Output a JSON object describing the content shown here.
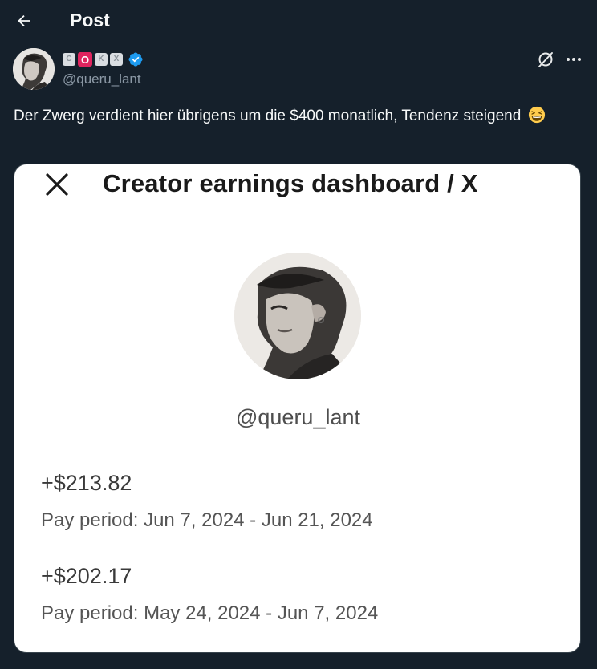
{
  "header": {
    "title": "Post"
  },
  "author": {
    "name_tiles": [
      "C",
      "O",
      "K",
      "X"
    ],
    "handle": "@queru_lant"
  },
  "tweet": {
    "text": "Der Zwerg verdient hier übrigens um die $400 monatlich, Tendenz steigend"
  },
  "dashboard": {
    "title": "Creator earnings dashboard / X",
    "handle": "@queru_lant",
    "payouts": [
      {
        "amount": "+$213.82",
        "period": "Pay period: Jun 7, 2024 - Jun 21, 2024"
      },
      {
        "amount": "+$202.17",
        "period": "Pay period: May 24, 2024 - Jun 7, 2024"
      }
    ]
  },
  "icons": {
    "back": "arrow-left-icon",
    "verified": "verified-badge-icon",
    "grok": "grok-icon",
    "more": "more-horizontal-icon",
    "emoji": "grinning-squinting-face-icon",
    "close": "close-icon"
  },
  "colors": {
    "background": "#15202b",
    "text_primary": "#f7f9f9",
    "text_secondary": "#8b98a5",
    "verified_blue": "#1d9bf0",
    "accent_red": "#e0245e"
  }
}
